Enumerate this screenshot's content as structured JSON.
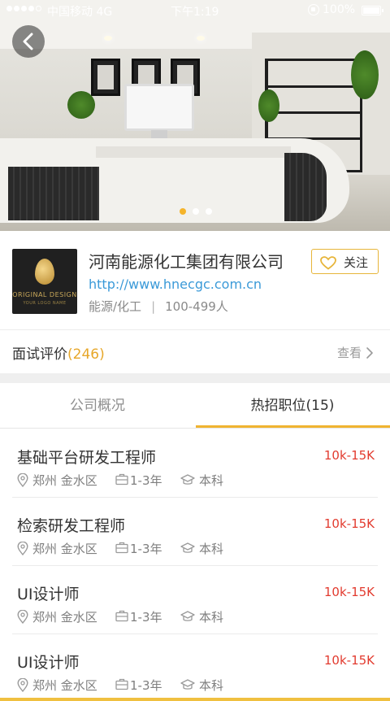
{
  "status_bar": {
    "carrier": "中国移动 4G",
    "time": "下午1:19",
    "battery": "100%"
  },
  "hero": {
    "carousel_pages": 3,
    "active_page": 1
  },
  "company": {
    "logo_text": "ORIGINAL DESIGN",
    "logo_subtext": "YOUR LOGO NAME",
    "name": "河南能源化工集团有限公司",
    "url": "http://www.hnecgc.com.cn",
    "industry": "能源/化工",
    "separator": "|",
    "size": "100-499人",
    "follow_label": "关注"
  },
  "interview": {
    "label": "面试评价",
    "count": "(246)",
    "view_label": "查看"
  },
  "tabs": [
    {
      "label": "公司概况",
      "active": false
    },
    {
      "label": "热招职位(15)",
      "active": true
    }
  ],
  "jobs": [
    {
      "title": "基础平台研发工程师",
      "salary": "10k-15K",
      "location": "郑州 金水区",
      "experience": "1-3年",
      "education": "本科"
    },
    {
      "title": "检索研发工程师",
      "salary": "10k-15K",
      "location": "郑州 金水区",
      "experience": "1-3年",
      "education": "本科"
    },
    {
      "title": "UI设计师",
      "salary": "10k-15K",
      "location": "郑州 金水区",
      "experience": "1-3年",
      "education": "本科"
    },
    {
      "title": "UI设计师",
      "salary": "10k-15K",
      "location": "郑州 金水区",
      "experience": "1-3年",
      "education": "本科"
    }
  ],
  "colors": {
    "accent": "#f0b431",
    "salary": "#e23b2f",
    "link": "#3b9ad8"
  }
}
